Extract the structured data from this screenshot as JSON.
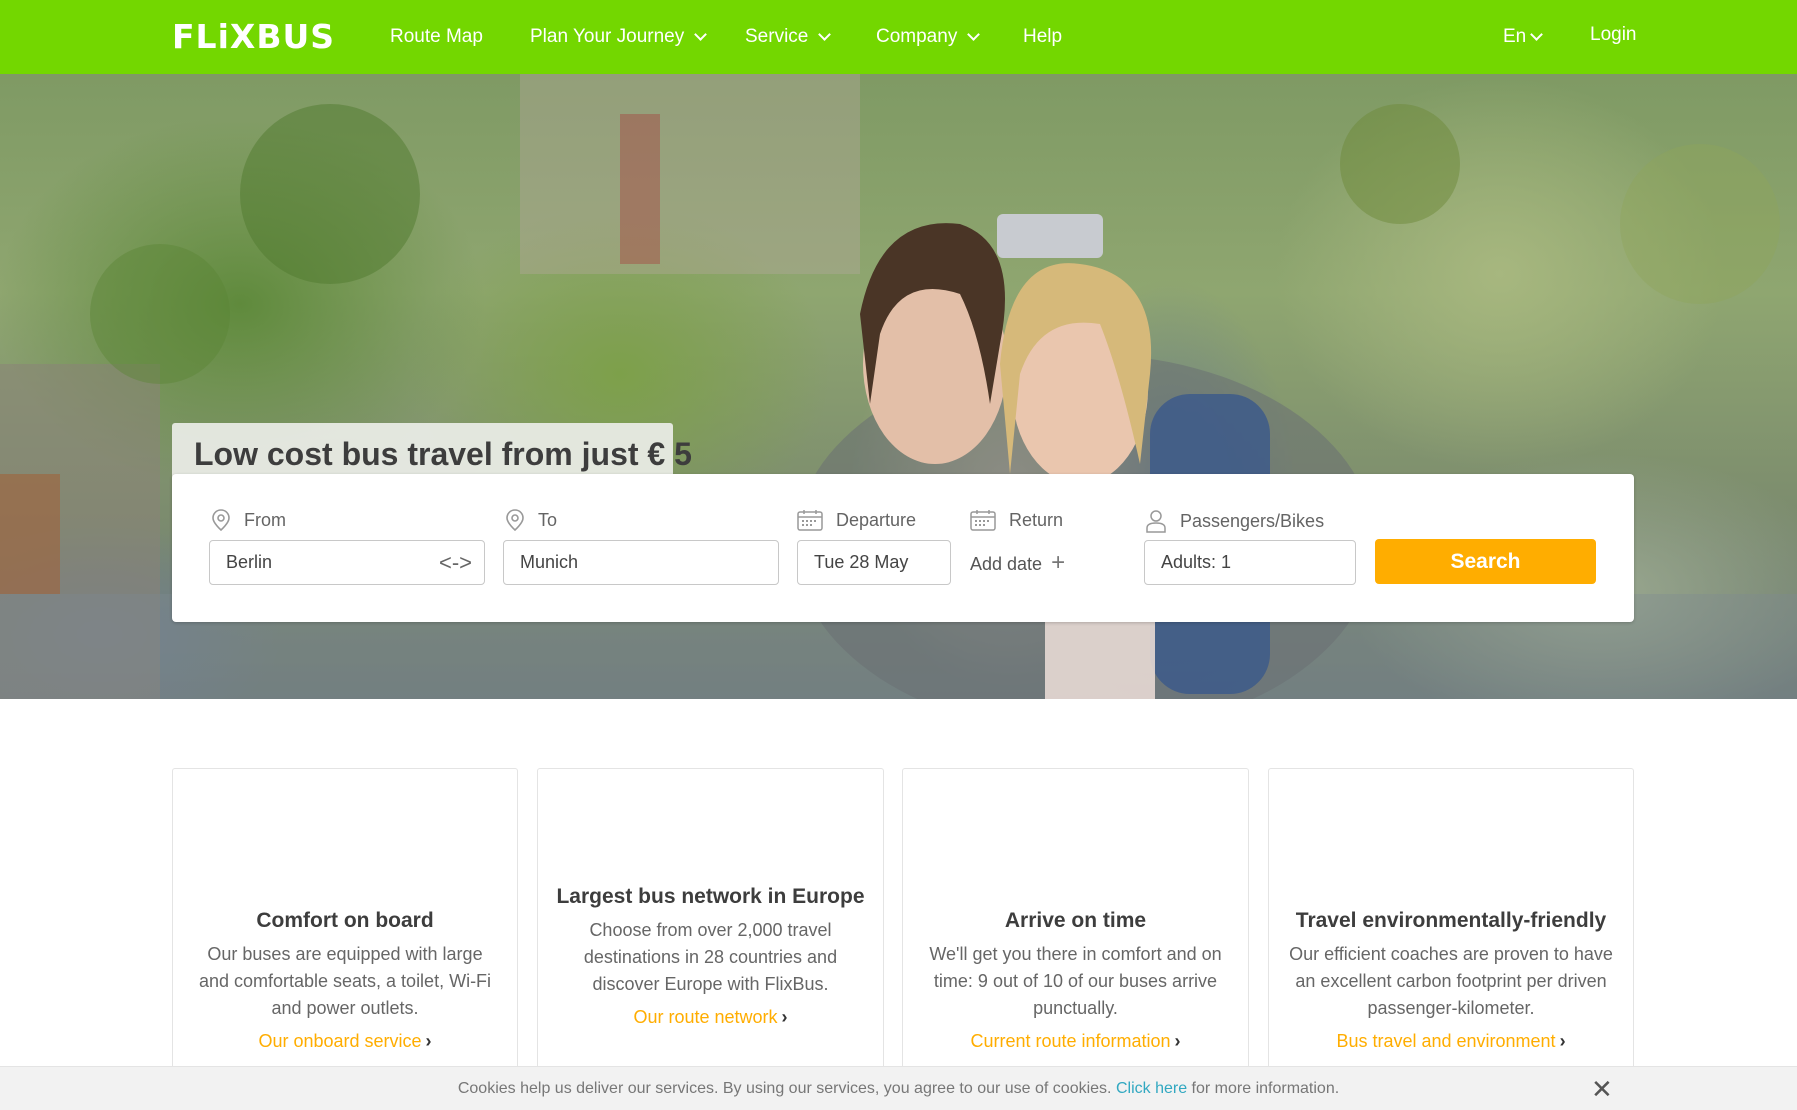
{
  "header": {
    "logo": "FLiXBUS",
    "nav": [
      {
        "label": "Route Map",
        "dropdown": false
      },
      {
        "label": "Plan Your Journey",
        "dropdown": true
      },
      {
        "label": "Service",
        "dropdown": true
      },
      {
        "label": "Company",
        "dropdown": true
      },
      {
        "label": "Help",
        "dropdown": false
      }
    ],
    "language": "En",
    "login": "Login"
  },
  "hero": {
    "title": "Low cost bus travel from just € 5"
  },
  "search": {
    "from_label": "From",
    "from_value": "Berlin",
    "to_label": "To",
    "to_value": "Munich",
    "departure_label": "Departure",
    "departure_value": "Tue 28 May",
    "return_label": "Return",
    "return_add": "Add date",
    "passengers_label": "Passengers/Bikes",
    "passengers_value": "Adults: 1",
    "search_button": "Search"
  },
  "features": [
    {
      "title": "Comfort on board",
      "text": "Our buses are equipped with large and comfortable seats, a toilet, Wi-Fi and power outlets.",
      "link": "Our onboard service"
    },
    {
      "title": "Largest bus network in Europe",
      "text": "Choose from over 2,000 travel destinations in 28 countries and discover Europe with FlixBus.",
      "link": "Our route network"
    },
    {
      "title": "Arrive on time",
      "text": "We'll get you there in comfort and on time: 9 out of 10 of our buses arrive punctually.",
      "link": "Current route information"
    },
    {
      "title": "Travel environmentally-friendly",
      "text": "Our efficient coaches are proven to have an excellent carbon footprint per driven passenger-kilometer.",
      "link": "Bus travel and environment"
    }
  ],
  "cookie": {
    "text_before": "Cookies help us deliver our services. By using our services, you agree to our use of cookies.",
    "link": "Click here",
    "text_after": "for more information."
  },
  "colors": {
    "brand_green": "#73d700",
    "accent_orange": "#ffad00",
    "link_blue": "#31a8c1"
  }
}
